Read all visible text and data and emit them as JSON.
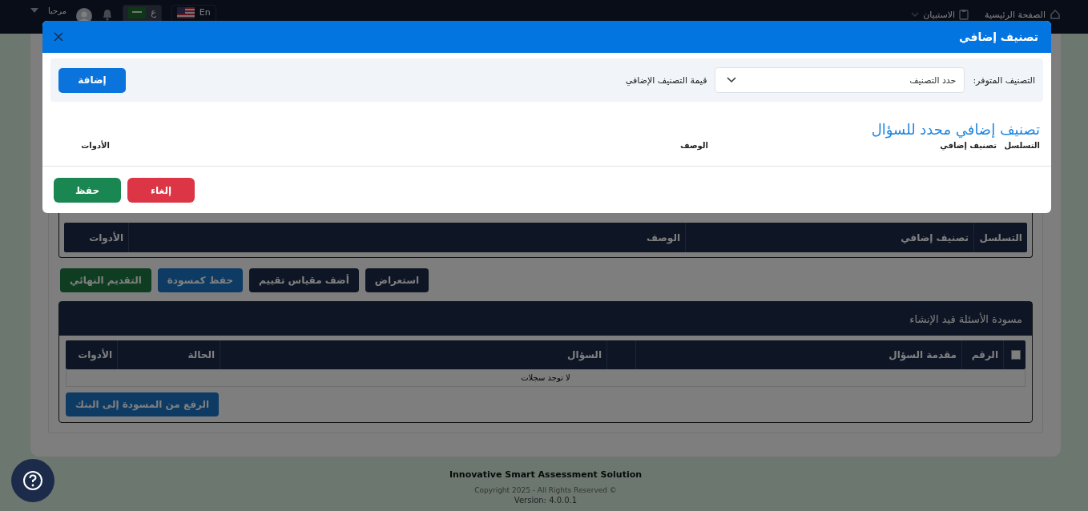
{
  "header": {
    "nav": [
      {
        "label": "الصفحة الرئيسية",
        "kind": "home"
      },
      {
        "label": "الاستبيان",
        "kind": "menu"
      }
    ],
    "languages": [
      {
        "label": "En",
        "kind": "us",
        "selected": false
      },
      {
        "label": "ع",
        "kind": "sa",
        "selected": true
      }
    ],
    "greeting": "مرحبا"
  },
  "page": {
    "classification_table": {
      "columns": [
        "التسلسل",
        "تصنيف إضافي",
        "الوصف",
        "الأدوات"
      ]
    },
    "actions": [
      {
        "label": "استعراض",
        "kind": "dark"
      },
      {
        "label": "أضف مقياس تقييم",
        "kind": "dark"
      },
      {
        "label": "حفظ كمسودة",
        "kind": "blue"
      },
      {
        "label": "التقديم النهائي",
        "kind": "green"
      }
    ],
    "drafts": {
      "title": "مسودة الأسئلة قيد الإنشاء",
      "columns": [
        {
          "kind": "checkbox",
          "checked": false
        },
        {
          "kind": "text",
          "label": "الرقم"
        },
        {
          "kind": "text",
          "label": "مقدمة السؤال"
        },
        {
          "kind": "blank"
        },
        {
          "kind": "text",
          "label": "السؤال"
        },
        {
          "kind": "text",
          "label": "الحالة"
        },
        {
          "kind": "text",
          "label": "الأدوات"
        }
      ],
      "empty": "لا توجد سجلات",
      "upload_button": "الرفع من المسودة إلى البنك"
    }
  },
  "footer": {
    "product": "Innovative Smart Assessment Solution",
    "copyright": "Copyright 2025 - All Rights Reserved ©",
    "version": "Version: 4.0.0.1"
  },
  "modal": {
    "title": "تصنيف إضافي",
    "filter": {
      "label": "التصنيف المتوفر:",
      "select_placeholder": "حدد التصنيف",
      "value_label": "قيمة التصنيف الإضافي",
      "add_button": "إضافة"
    },
    "section_title": "تصنيف إضافي محدد للسؤال",
    "columns": [
      "التسلسل",
      "تصنيف إضافي",
      "الوصف",
      "الأدوات"
    ],
    "buttons": [
      {
        "label": "إلغاء",
        "kind": "red"
      },
      {
        "label": "حفظ",
        "kind": "green"
      }
    ]
  }
}
